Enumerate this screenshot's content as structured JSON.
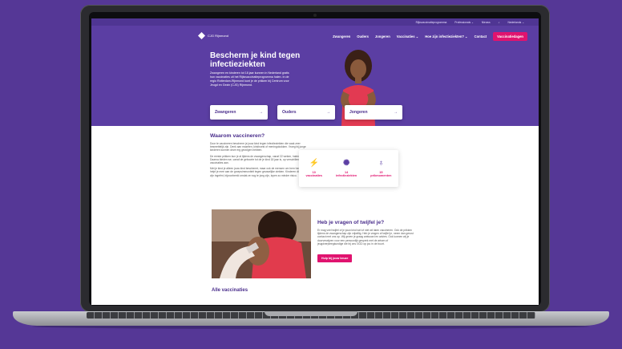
{
  "top_bar": {
    "items": [
      "Rijksvaccinatieprogramma",
      "Professionals ⌄",
      "Nieuws",
      "⌕",
      "Nederlands ⌄"
    ]
  },
  "nav": {
    "logo_text": "CJG Rijnmond",
    "items": [
      "Zwangeren",
      "Ouders",
      "Jongeren",
      "Vaccinaties ⌄",
      "Hoe zijn infectieziekten? ⌄",
      "Contact"
    ],
    "cta": "Vaccinatiedagen"
  },
  "hero": {
    "title": "Bescherm je kind tegen infectieziekten",
    "text": "Zwangeren en kinderen tot 18 jaar kunnen in Nederland gratis hun vaccinaties uit het Rijksvaccinatieprogramma halen. In de regio Rotterdam-Rijnmond kunt je de prikken bij Centrum voor Jeugd en Gezin (CJG) Rijnmond."
  },
  "cards": [
    {
      "label": "Zwangeren",
      "arrow": "→"
    },
    {
      "label": "Ouders",
      "arrow": "→"
    },
    {
      "label": "Jongeren",
      "arrow": "→"
    }
  ],
  "why": {
    "title": "Waarom vaccineren?",
    "paragraphs": [
      "Door te vaccineren bescherm je jouw kind tegen infectieziekten die vaak zeer besmettelijk zijn. Denk aan mazelen, kinkhoest of meningokokken. Vroeg bij jonge kinderen kunnen deze erg gevolgen hebben.",
      "De eerste prikken kun je al tijdens de zwangerschap, vanaf 22 weken, halen. Daarna bieden we, vanaf de geboorte tot de je kind 18 jaar is, op verschillende vaccinaties aan.",
      "Met je kind je alleen jouw kind beschermt, maar ook de mensen om hem heen! Zo helpt je mee aan de groepsimmuniteit tegen gevaarlijke ziekten. Kinderen die niet zijn ingeënt, bijvoorbeeld omdat ze nog te jong zijn, lopen zo minder risico."
    ]
  },
  "stats": [
    {
      "icon": "syringe-icon",
      "glyph": "⚡",
      "line1": "10",
      "line2": "vaccinaties"
    },
    {
      "icon": "virus-icon",
      "glyph": "✺",
      "line1": "14",
      "line2": "infectieziekten"
    },
    {
      "icon": "lightbulb-icon",
      "glyph": "♁",
      "line1": "15",
      "line2": "prikmomenten"
    }
  ],
  "doubt": {
    "title": "Heb je vragen of twijfel je?",
    "text": "Er mag veel twijfel of je jouw kind wel of niet wil laten vaccineren. Ook de prikken tijdens de zwangerschap zijn vrijwillig. Heb je vragen of twijfel je, neem dan gerust contact met ons op. Wij geven je graag antwoord en advies. Ook kunnen wij je doorverwijzen voor een persoonlijk gesprek met de artsen of jeugdverpleegkundige die bij ons GGD op jou in de buurt.",
    "button": "Hulp bij jouw keuze"
  },
  "all_vaccinations": "Alle vaccinaties"
}
